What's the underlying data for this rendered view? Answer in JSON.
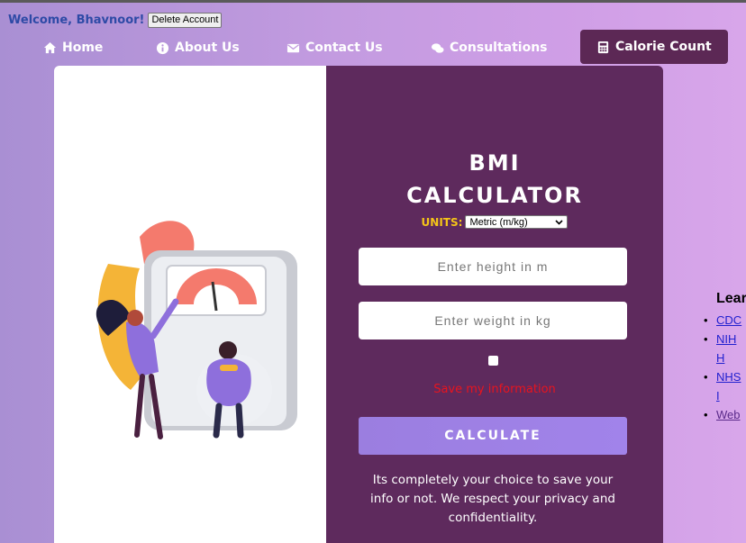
{
  "header": {
    "welcome": "Welcome, Bhavnoor!",
    "delete_account": "Delete Account"
  },
  "nav": {
    "items": [
      {
        "label": "Home",
        "icon": "home-icon"
      },
      {
        "label": "About Us",
        "icon": "info-icon"
      },
      {
        "label": "Contact Us",
        "icon": "envelope-icon"
      },
      {
        "label": "Consultations",
        "icon": "chat-icon"
      },
      {
        "label": "Calorie Count",
        "icon": "calculator-icon",
        "active": true
      }
    ]
  },
  "calculator": {
    "title_line1": "BMI",
    "title_line2": "CALCULATOR",
    "units_label": "UNITS:",
    "units_value": "Metric (m/kg)",
    "height_placeholder": "Enter height in m",
    "weight_placeholder": "Enter weight in kg",
    "save_label": "Save my information",
    "save_checked": false,
    "calculate_label": "CALCULATE",
    "privacy_note": "Its completely your choice to save your info or not. We respect your privacy and confidentiality."
  },
  "learn": {
    "title": "Lear",
    "links": [
      "CDC",
      "NIH H",
      "NHS I",
      "Web"
    ]
  },
  "colors": {
    "accent_dark": "#5e2a5d",
    "units_label": "#f5c518",
    "save_label": "#e8141e",
    "button": "#9b7ee0"
  }
}
